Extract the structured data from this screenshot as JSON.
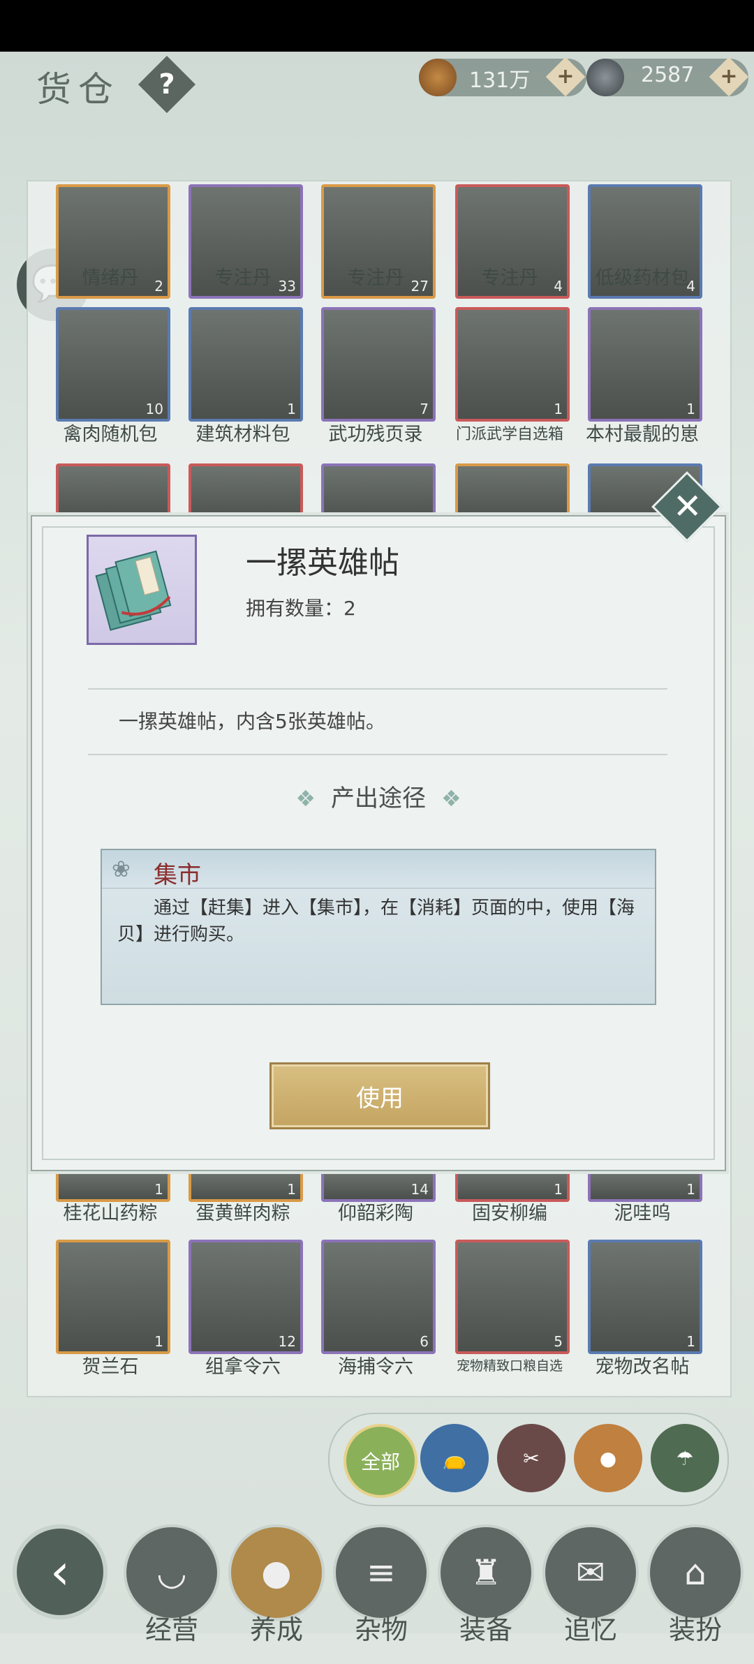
{
  "header": {
    "title": "货仓",
    "help_icon": "?",
    "copper": "131万",
    "silver": "2587",
    "plus": "+"
  },
  "grid": {
    "row1": [
      {
        "name": "情绪丹",
        "count": "2"
      },
      {
        "name": "专注丹",
        "count": "33"
      },
      {
        "name": "专注丹",
        "count": "27"
      },
      {
        "name": "专注丹",
        "count": "4"
      },
      {
        "name": "低级药材包",
        "count": "4"
      }
    ],
    "row2": [
      {
        "name": "禽肉随机包",
        "count": "10"
      },
      {
        "name": "建筑材料包",
        "count": "1"
      },
      {
        "name": "武功残页录",
        "count": "7"
      },
      {
        "name": "门派武学自选箱",
        "count": "1"
      },
      {
        "name": "本村最靓的崽",
        "count": "1"
      }
    ],
    "row4": [
      {
        "name": "桂花山药粽",
        "count": "1"
      },
      {
        "name": "蛋黄鲜肉粽",
        "count": "1"
      },
      {
        "name": "仰韶彩陶",
        "count": "14"
      },
      {
        "name": "固安柳编",
        "count": "1"
      },
      {
        "name": "泥哇呜",
        "count": "1"
      }
    ],
    "row5": [
      {
        "name": "贺兰石",
        "count": "1"
      },
      {
        "name": "组拿令六",
        "count": "12"
      },
      {
        "name": "海捕令六",
        "count": "6"
      },
      {
        "name": "宠物精致口粮自选",
        "count": "5"
      },
      {
        "name": "宠物改名帖",
        "count": "1"
      }
    ]
  },
  "filters": {
    "all": "全部"
  },
  "nav": {
    "items": [
      "经营",
      "养成",
      "杂物",
      "装备",
      "追忆",
      "装扮"
    ]
  },
  "modal": {
    "item_name": "一摞英雄帖",
    "quantity": "拥有数量：2",
    "description": "一摞英雄帖，内含5张英雄帖。",
    "source_heading": "产出途径",
    "source_name": "集市",
    "source_text": "通过【赶集】进入【集市】，在【消耗】页面的中，使用【海贝】进行购买。",
    "use_button": "使用",
    "close": "✕"
  }
}
